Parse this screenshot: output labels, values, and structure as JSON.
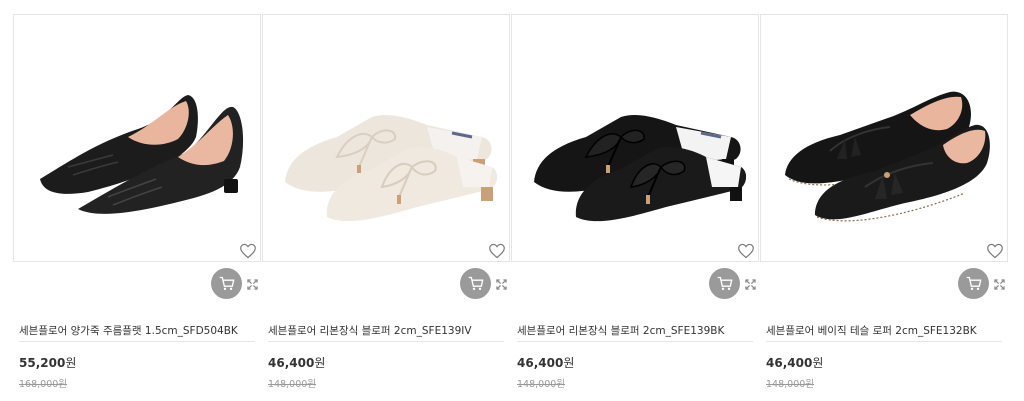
{
  "products": [
    {
      "name": "세븐플로어 양가죽 주름플랫 1.5cm_SFD504BK",
      "price": "55,200",
      "currency": "원",
      "old_price": "168,000원",
      "shoe_color": "#1c1c1c",
      "lining_color": "#e9b59c",
      "image_icon": "pointed-flat-shoe-image"
    },
    {
      "name": "세븐플로어 리본장식 블로퍼 2cm_SFE139IV",
      "price": "46,400",
      "currency": "원",
      "old_price": "148,000원",
      "shoe_color": "#ece6dc",
      "lining_color": "#f4f1ee",
      "image_icon": "ivory-bow-mule-image"
    },
    {
      "name": "세븐플로어 리본장식 블로퍼 2cm_SFE139BK",
      "price": "46,400",
      "currency": "원",
      "old_price": "148,000원",
      "shoe_color": "#151515",
      "lining_color": "#f3f3f3",
      "image_icon": "black-bow-mule-image"
    },
    {
      "name": "세븐플로어 베이직 테슬 로퍼 2cm_SFE132BK",
      "price": "46,400",
      "currency": "원",
      "old_price": "148,000원",
      "shoe_color": "#151515",
      "lining_color": "#e9b59c",
      "image_icon": "tassel-loafer-image"
    }
  ],
  "icons": {
    "wishlist": "heart-icon",
    "cart": "cart-icon",
    "quick_view": "expand-icon"
  },
  "colors": {
    "cart_button_bg": "#9a9a9a",
    "border": "#e5e5e5",
    "text": "#333333",
    "muted": "#999999"
  }
}
